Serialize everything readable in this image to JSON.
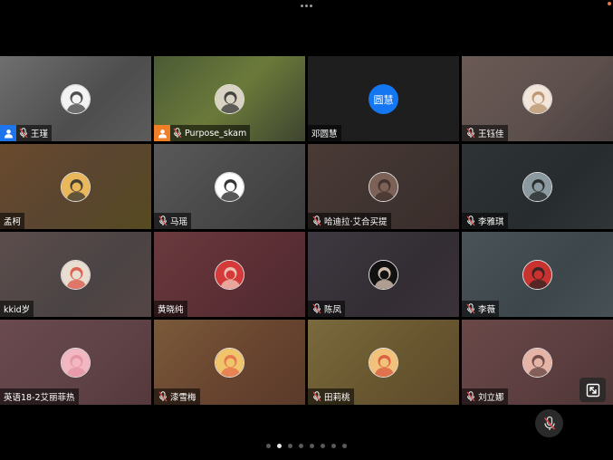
{
  "participants": [
    {
      "name": "王瑾",
      "host_badge": true,
      "host_color": "#1e74ea",
      "mic_off": true,
      "bg": "linear-gradient(135deg,#6f6f6f,#4d4d4d 60%,#5c5c5c)",
      "avatar_icon": "cartoon-girl-avatar",
      "avatar_colors": [
        "#f3f3f3",
        "#333333"
      ]
    },
    {
      "name": "Purpose_skam",
      "host_badge": true,
      "host_color": "#f07f27",
      "mic_off": true,
      "bg": "linear-gradient(135deg,#4b5a35,#6b7a3a 50%,#3e4430)",
      "avatar_icon": "photo-girl-avatar",
      "avatar_colors": [
        "#d9d3c4",
        "#2a2a2a"
      ]
    },
    {
      "name": "邓圆慧",
      "host_badge": false,
      "mic_off": false,
      "bg": "#1e1e1e",
      "avatar_text": "圆慧",
      "avatar_icon": "text-avatar"
    },
    {
      "name": "王钰佳",
      "host_badge": false,
      "mic_off": true,
      "bg": "linear-gradient(135deg,#6b5a55,#5c4f4c 60%,#4a4040)",
      "avatar_icon": "anime-boy-avatar",
      "avatar_colors": [
        "#f2e6da",
        "#b58a62"
      ]
    },
    {
      "name": "孟柯",
      "host_badge": false,
      "mic_off": false,
      "bg": "linear-gradient(135deg,#6a4a2d,#5a4530 50%,#564a20)",
      "avatar_icon": "chibi-maruko-avatar",
      "avatar_colors": [
        "#e8b85a",
        "#2a2a2a"
      ]
    },
    {
      "name": "马瑶",
      "host_badge": false,
      "mic_off": true,
      "bg": "linear-gradient(135deg,#595959,#474747 60%,#3c3c3c)",
      "avatar_icon": "silhouette-avatar",
      "avatar_colors": [
        "#ffffff",
        "#111111"
      ]
    },
    {
      "name": "哈迪拉·艾合买提",
      "host_badge": false,
      "mic_off": true,
      "bg": "linear-gradient(135deg,#4a3a36,#3e3330 60%,#3a2c2a)",
      "avatar_icon": "photo-woman-avatar",
      "avatar_colors": [
        "#7b6156",
        "#3b2b28"
      ]
    },
    {
      "name": "李雅琪",
      "host_badge": false,
      "mic_off": true,
      "bg": "linear-gradient(135deg,#2e3336,#272c2e 60%,#303538)",
      "avatar_icon": "photo-girl-dark-avatar",
      "avatar_colors": [
        "#8a9aa0",
        "#1a1a1a"
      ]
    },
    {
      "name": "kkid岁",
      "host_badge": false,
      "mic_off": false,
      "bg": "linear-gradient(135deg,#5c4d4c,#4b4444 60%,#554545)",
      "avatar_icon": "cartoon-animal-avatar",
      "avatar_colors": [
        "#e9ddd0",
        "#d94c3c"
      ]
    },
    {
      "name": "黄晓纯",
      "host_badge": false,
      "mic_off": false,
      "bg": "linear-gradient(135deg,#6a3a3e,#5a2e34 60%,#4d2a2e)",
      "avatar_icon": "anime-redhair-avatar",
      "avatar_colors": [
        "#d43a3a",
        "#f2d6c6"
      ]
    },
    {
      "name": "陈凤",
      "host_badge": false,
      "mic_off": true,
      "bg": "linear-gradient(135deg,#3e3840,#332e34 60%,#3a3238)",
      "avatar_icon": "anime-darkhair-avatar",
      "avatar_colors": [
        "#111111",
        "#f3d9c7"
      ]
    },
    {
      "name": "李薇",
      "host_badge": false,
      "mic_off": true,
      "bg": "linear-gradient(135deg,#4a5458,#3d474b 60%,#465055)",
      "avatar_icon": "anime-witch-avatar",
      "avatar_colors": [
        "#c8322f",
        "#222222"
      ]
    },
    {
      "name": "英语18-2艾丽菲热",
      "host_badge": false,
      "mic_off": false,
      "bg": "linear-gradient(135deg,#6a4a4e,#5e4246 60%,#54383c)",
      "avatar_icon": "cartoon-pig-avatar",
      "avatar_colors": [
        "#f2b8c2",
        "#e48ea0"
      ]
    },
    {
      "name": "漆雪梅",
      "host_badge": false,
      "mic_off": true,
      "bg": "linear-gradient(135deg,#7a5a3a,#6a4630 50%,#5a3a2a)",
      "avatar_icon": "cartoon-food-avatar",
      "avatar_colors": [
        "#f0c46a",
        "#e46a4a"
      ]
    },
    {
      "name": "田莉桃",
      "host_badge": false,
      "mic_off": true,
      "bg": "linear-gradient(135deg,#7a6a3e,#6a5830 50%,#5c4a2c)",
      "avatar_icon": "cartoon-character-avatar",
      "avatar_colors": [
        "#f2c27a",
        "#d8503a"
      ]
    },
    {
      "name": "刘立娜",
      "host_badge": false,
      "mic_off": true,
      "bg": "linear-gradient(135deg,#6a4848,#5c3e40 60%,#4e3636)",
      "avatar_icon": "photo-pink-avatar",
      "avatar_colors": [
        "#e6b4a6",
        "#5a3a3a"
      ]
    }
  ],
  "pagination": {
    "total": 8,
    "active": 1
  },
  "controls": {
    "mic_button_icon": "mic-off-icon",
    "expand_button_icon": "expand-icon"
  }
}
